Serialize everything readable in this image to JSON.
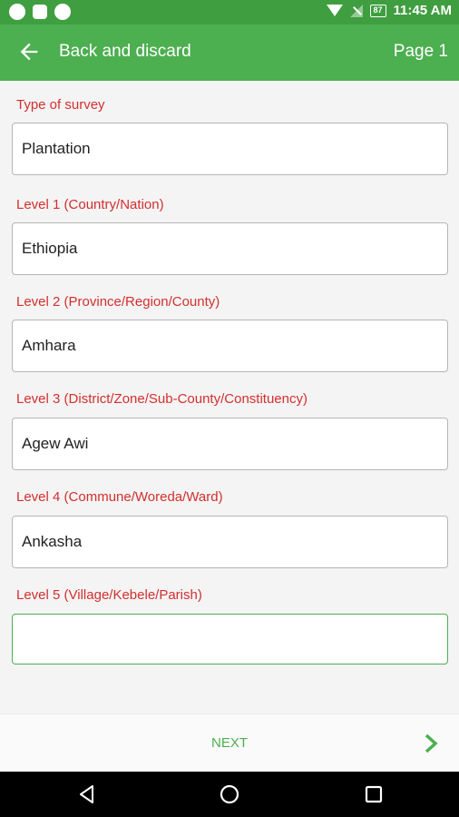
{
  "status_bar": {
    "time": "11:45 AM",
    "battery": "87",
    "icons": [
      "app-notification-icon",
      "sync-icon",
      "android-icon",
      "wifi-icon",
      "no-signal-icon",
      "battery-icon"
    ]
  },
  "app_bar": {
    "back_icon": "arrow-back-icon",
    "title": "Back and discard",
    "page": "Page 1"
  },
  "form": {
    "fields": [
      {
        "label": "Type of survey",
        "value": "Plantation"
      },
      {
        "label": "Level 1 (Country/Nation)",
        "value": "Ethiopia"
      },
      {
        "label": "Level 2 (Province/Region/County)",
        "value": "Amhara"
      },
      {
        "label": "Level 3 (District/Zone/Sub-County/Constituency)",
        "value": "Agew Awi"
      },
      {
        "label": "Level 4 (Commune/Woreda/Ward)",
        "value": "Ankasha"
      },
      {
        "label": "Level 5 (Village/Kebele/Parish)",
        "value": ""
      }
    ]
  },
  "bottom_bar": {
    "next_label": "NEXT",
    "next_icon": "chevron-right-icon"
  },
  "colors": {
    "status_bar": "#3f9e3f",
    "app_bar": "#4caf50",
    "label_red": "#d32f2f",
    "accent_green": "#4caf50"
  },
  "nav_bar": {
    "icons": [
      "back-triangle-icon",
      "home-circle-icon",
      "recents-square-icon"
    ]
  }
}
